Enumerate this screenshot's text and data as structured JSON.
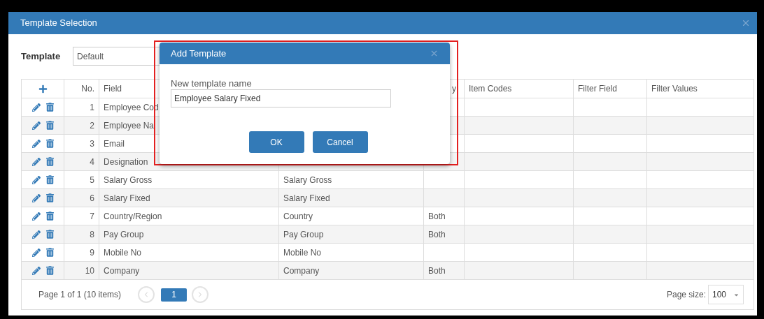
{
  "window": {
    "title": "Template Selection"
  },
  "template": {
    "label": "Template",
    "value": "Default"
  },
  "table": {
    "columns": [
      {
        "kind": "add"
      },
      {
        "kind": "text",
        "label": "No."
      },
      {
        "kind": "text",
        "label": "Field"
      },
      {
        "kind": "text"
      },
      {
        "kind": "text",
        "label": "y"
      },
      {
        "kind": "text",
        "label": "Item Codes"
      },
      {
        "kind": "text",
        "label": "Filter Field"
      },
      {
        "kind": "text",
        "label": "Filter Values"
      }
    ],
    "rows": [
      {
        "cells": [
          "",
          "1",
          "Employee Cod"
        ]
      },
      {
        "cells": [
          "",
          "2",
          "Employee Na"
        ]
      },
      {
        "cells": [
          "",
          "3",
          "Email"
        ]
      },
      {
        "cells": [
          "",
          "4",
          "Designation"
        ]
      },
      {
        "cells": [
          "",
          "5",
          "Salary Gross",
          "Salary Gross"
        ]
      },
      {
        "cells": [
          "",
          "6",
          "Salary Fixed",
          "Salary Fixed"
        ]
      },
      {
        "cells": [
          "",
          "7",
          "Country/Region",
          "Country",
          "Both"
        ]
      },
      {
        "cells": [
          "",
          "8",
          "Pay Group",
          "Pay Group",
          "Both"
        ]
      },
      {
        "cells": [
          "",
          "9",
          "Mobile No",
          "Mobile No"
        ]
      },
      {
        "cells": [
          "",
          "10",
          "Company",
          "Company",
          "Both"
        ]
      }
    ]
  },
  "pager": {
    "summary": "Page 1 of 1 (10 items)",
    "pages": [
      {
        "label": "1",
        "selected": true
      }
    ],
    "page_size_label": "Page size:",
    "page_size": "100"
  },
  "dialog": {
    "title": "Add Template",
    "highlighted": true,
    "field_label": "New template name",
    "field_value": "Employee Salary Fixed",
    "buttons": [
      "OK",
      "Cancel"
    ]
  }
}
